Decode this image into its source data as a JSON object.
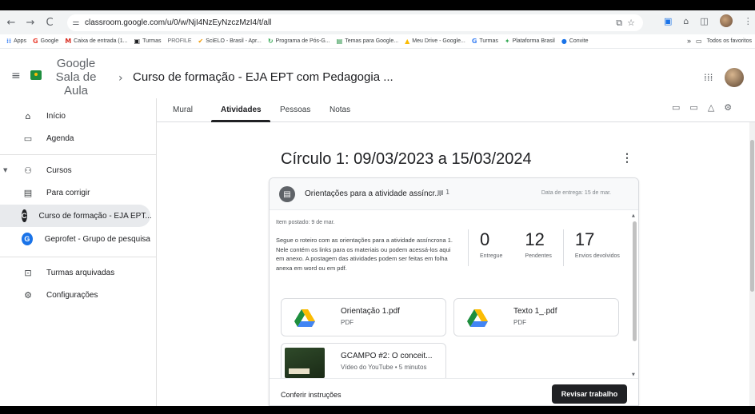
{
  "browser": {
    "url": "classroom.google.com/u/0/w/NjI4NzEyNzczMzI4/t/all",
    "nav_back": "←",
    "nav_forward": "→",
    "nav_reload": "C",
    "omni_icons": [
      "translate-icon",
      "star-icon"
    ],
    "bookmarks": [
      {
        "icon": "apps-grid-icon",
        "label": "Apps",
        "color": "#4285f4"
      },
      {
        "icon": "google-icon",
        "label": "Google",
        "color": "#ea4335"
      },
      {
        "icon": "gmail-icon",
        "label": "Caixa de entrada (1...",
        "color": "#d93025"
      },
      {
        "icon": "classroom-icon",
        "label": "Turmas",
        "color": "#202124"
      },
      {
        "icon": "profile-text",
        "label": "PROFILE",
        "color": "#5f6368"
      },
      {
        "icon": "scielo-icon",
        "label": "SciELO - Brasil - Apr...",
        "color": "#f29900"
      },
      {
        "icon": "capes-icon",
        "label": "Programa de Pós-G...",
        "color": "#34a853"
      },
      {
        "icon": "sheets-icon",
        "label": "Temas para Google...",
        "color": "#1e8e3e"
      },
      {
        "icon": "drive-icon",
        "label": "Meu Drive - Google...",
        "color": "#fbbc04"
      },
      {
        "icon": "google-icon",
        "label": "Turmas",
        "color": "#4285f4"
      },
      {
        "icon": "plataforma-icon",
        "label": "Plataforma Brasil",
        "color": "#34a853"
      },
      {
        "icon": "convite-icon",
        "label": "Convite",
        "color": "#1a73e8"
      }
    ],
    "bookmarks_more": "»",
    "all_bookmarks": "Todos os favoritos"
  },
  "header": {
    "brand_line1": "Google",
    "brand_line2": "Sala de",
    "brand_line3": "Aula",
    "breadcrumb_sep": "›",
    "course_title": "Curso de formação - EJA EPT com Pedagogia ..."
  },
  "tabs": [
    {
      "label": "Mural",
      "active": false
    },
    {
      "label": "Atividades",
      "active": true
    },
    {
      "label": "Pessoas",
      "active": false
    },
    {
      "label": "Notas",
      "active": false
    }
  ],
  "sidebar": {
    "items": [
      {
        "label": "Início",
        "icon": "home-icon"
      },
      {
        "label": "Agenda",
        "icon": "calendar-icon"
      },
      {
        "label": "Cursos",
        "icon": "people-icon"
      },
      {
        "label": "Para corrigir",
        "icon": "todo-folder-icon"
      },
      {
        "label": "Curso de formação - EJA EPT...",
        "icon": "course-avatar",
        "letter": "C",
        "color": "#202124"
      },
      {
        "label": "Geprofet - Grupo de pesquisa",
        "icon": "course-avatar",
        "letter": "G",
        "color": "#1a73e8"
      },
      {
        "label": "Turmas arquivadas",
        "icon": "archive-icon"
      },
      {
        "label": "Configurações",
        "icon": "settings-icon"
      }
    ]
  },
  "topic": {
    "title": "Círculo 1: 09/03/2023 a 15/03/2024"
  },
  "assignment": {
    "title": "Orientações para a atividade assíncr...",
    "comment_count": "1",
    "due": "Data de entrega: 15 de mar.",
    "posted": "Item postado: 9 de mar.",
    "description": "Segue o roteiro com as orientações para a atividade assíncrona 1. Nele contém os links para os materiais ou podem acessá-los aqui em anexo. A postagem das atividades podem ser feitas em folha anexa em word ou em pdf.",
    "stats": [
      {
        "num": "0",
        "label": "Entregue"
      },
      {
        "num": "12",
        "label": "Pendentes"
      },
      {
        "num": "17",
        "label": "Envios devolvidos"
      }
    ],
    "attachments": [
      {
        "title": "Orientação 1.pdf",
        "sub": "PDF",
        "kind": "drive-icon"
      },
      {
        "title": "Texto 1_.pdf",
        "sub": "PDF",
        "kind": "drive-icon"
      },
      {
        "title": "GCAMPO #2: O conceit...",
        "sub": "Vídeo do YouTube • 5 minutos",
        "kind": "youtube-thumbnail"
      }
    ],
    "footer_link": "Conferir instruções",
    "review_button": "Revisar trabalho"
  }
}
